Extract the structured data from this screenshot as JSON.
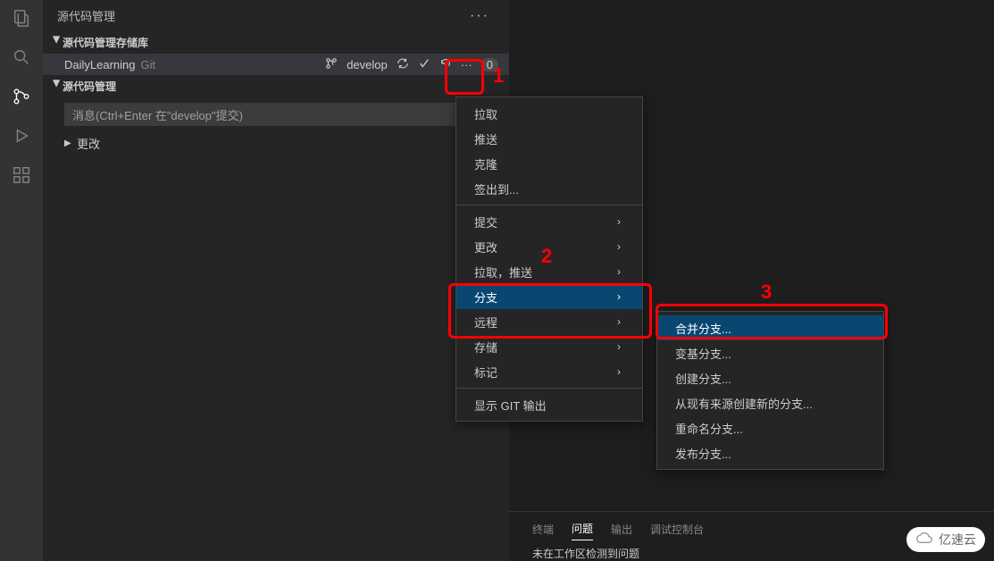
{
  "sidebar": {
    "title": "源代码管理",
    "sections": {
      "repos": "源代码管理存储库",
      "scm": "源代码管理",
      "changes": "更改"
    },
    "repo": {
      "name": "DailyLearning",
      "type": "Git",
      "branch": "develop",
      "incoming": "0"
    },
    "commit_placeholder": "消息(Ctrl+Enter 在\"develop\"提交)"
  },
  "menu": {
    "items": [
      {
        "label": "拉取",
        "arrow": false
      },
      {
        "label": "推送",
        "arrow": false
      },
      {
        "label": "克隆",
        "arrow": false
      },
      {
        "label": "签出到...",
        "arrow": false
      },
      {
        "sep": true
      },
      {
        "label": "提交",
        "arrow": true
      },
      {
        "label": "更改",
        "arrow": true
      },
      {
        "label": "拉取，推送",
        "arrow": true
      },
      {
        "label": "分支",
        "arrow": true,
        "hovered": true
      },
      {
        "label": "远程",
        "arrow": true
      },
      {
        "label": "存储",
        "arrow": true
      },
      {
        "label": "标记",
        "arrow": true
      },
      {
        "sep": true
      },
      {
        "label": "显示 GIT 输出",
        "arrow": false
      }
    ]
  },
  "submenu": {
    "items": [
      {
        "label": "合并分支...",
        "hovered": true
      },
      {
        "label": "变基分支...",
        "hovered": false
      },
      {
        "label": "创建分支...",
        "hovered": false
      },
      {
        "label": "从现有来源创建新的分支...",
        "hovered": false
      },
      {
        "label": "重命名分支...",
        "hovered": false
      },
      {
        "label": "发布分支...",
        "hovered": false
      }
    ]
  },
  "annotations": {
    "n1": "1",
    "n2": "2",
    "n3": "3"
  },
  "panel": {
    "tabs": {
      "terminal": "终端",
      "problems": "问题",
      "output": "输出",
      "debug": "调试控制台"
    },
    "message": "未在工作区检测到问题"
  },
  "watermark": "亿速云"
}
